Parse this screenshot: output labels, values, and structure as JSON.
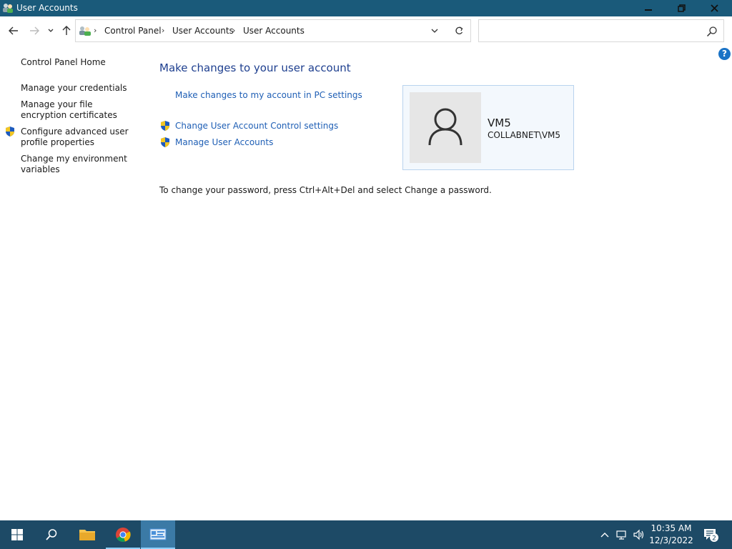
{
  "window": {
    "title": "User Accounts"
  },
  "address": {
    "crumbs": [
      "Control Panel",
      "User Accounts",
      "User Accounts"
    ]
  },
  "search": {
    "placeholder": "",
    "value": ""
  },
  "sidebar": {
    "items": [
      {
        "label": "Control Panel Home"
      },
      {
        "label": "Manage your credentials"
      },
      {
        "label": "Manage your file encryption certificates"
      },
      {
        "label": "Configure advanced user profile properties"
      },
      {
        "label": "Change my environment variables"
      }
    ]
  },
  "main": {
    "title": "Make changes to your user account",
    "links": [
      {
        "label": "Make changes to my account in PC settings"
      },
      {
        "label": "Change User Account Control settings"
      },
      {
        "label": "Manage User Accounts"
      }
    ],
    "password_note": "To change your password, press Ctrl+Alt+Del and select Change a password."
  },
  "account": {
    "name": "VM5",
    "domain": "COLLABNET\\VM5"
  },
  "taskbar": {
    "time": "10:35 AM",
    "date": "12/3/2022",
    "notification_count": "2"
  },
  "colors": {
    "titlebar": "#1a5a7a",
    "taskbar": "#1d4a66",
    "link": "#1f5fb5",
    "heading": "#1e3f8f"
  }
}
